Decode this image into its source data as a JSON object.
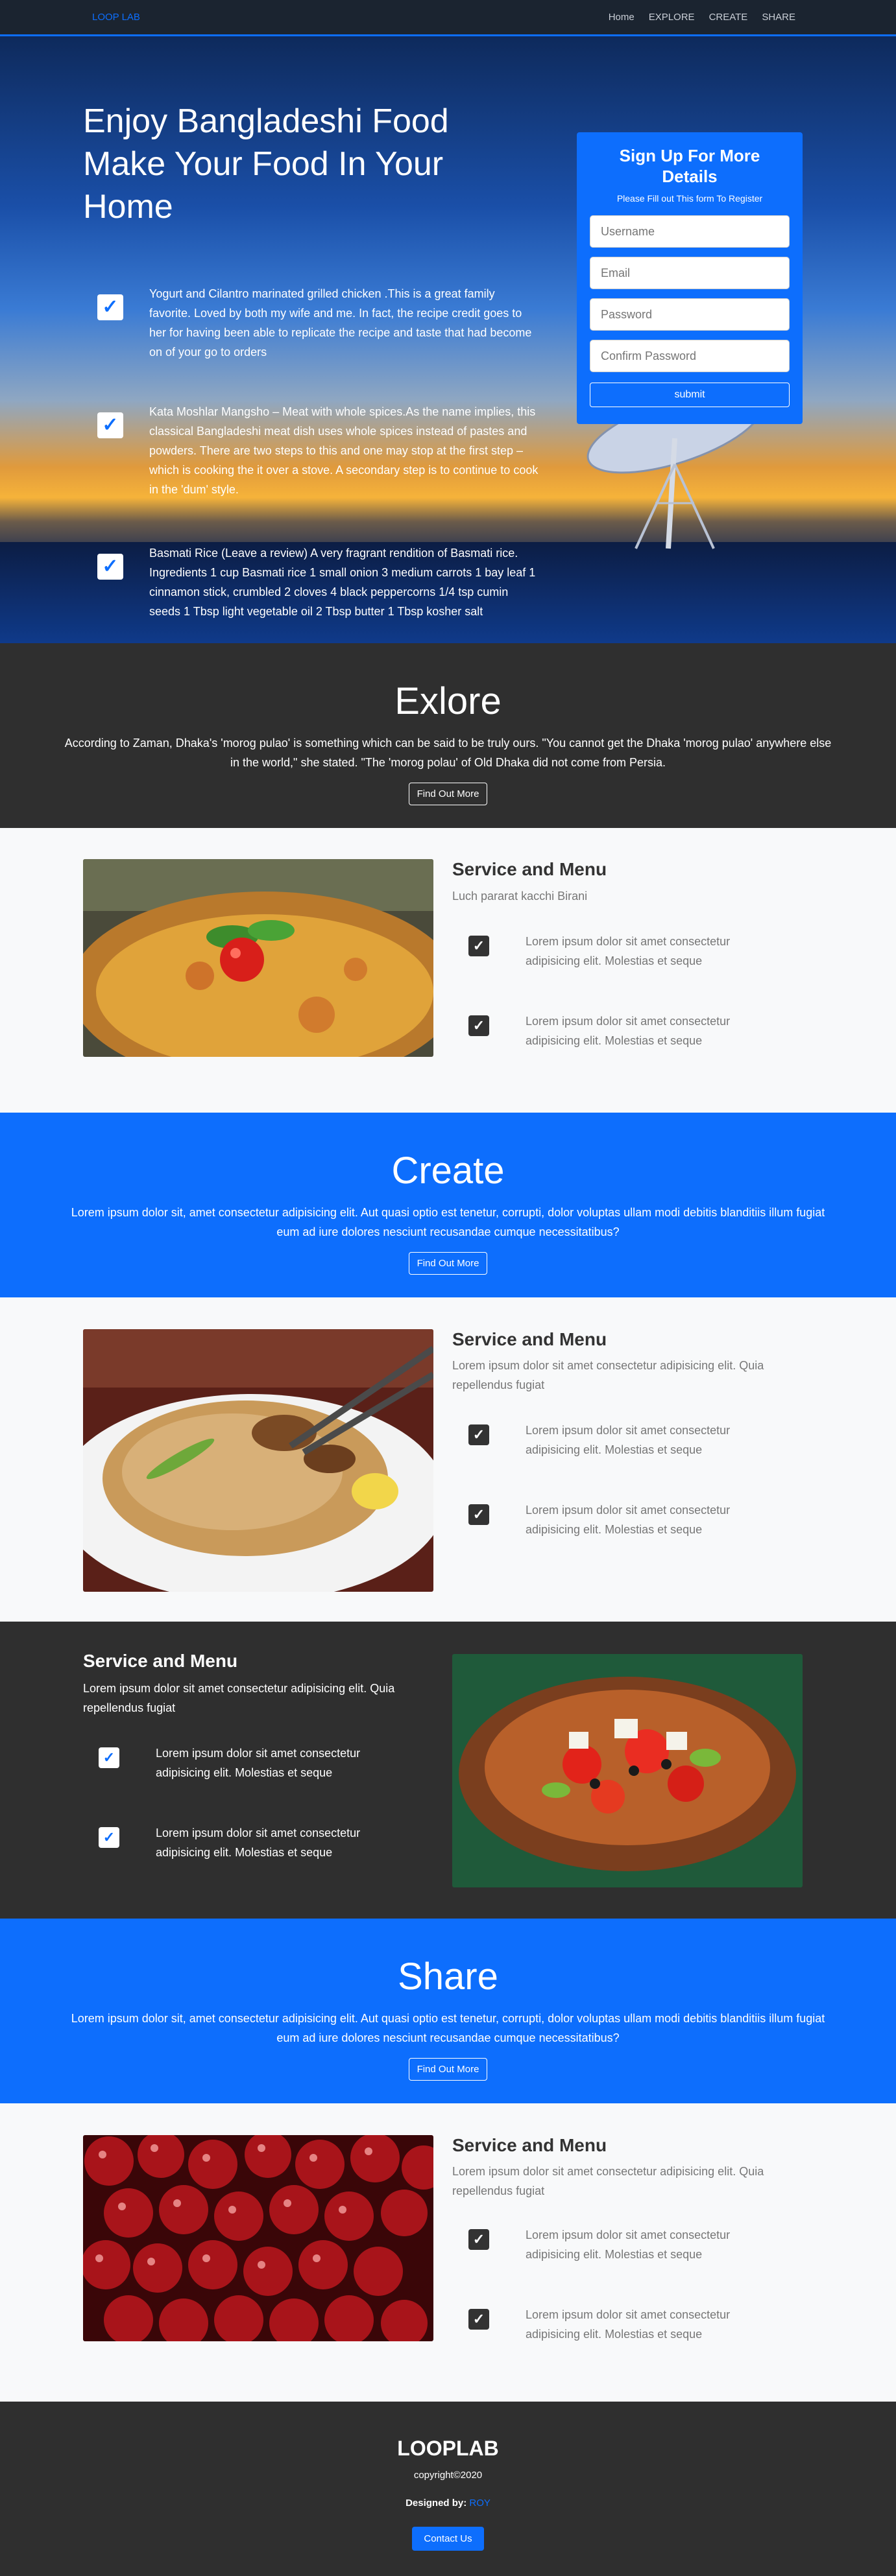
{
  "nav": {
    "brand": "LOOP LAB",
    "links": [
      "Home",
      "EXPLORE",
      "CREATE",
      "SHARE"
    ]
  },
  "hero": {
    "title_line1": "Enjoy Bangladeshi Food",
    "title_line2_light": "Make Your Food",
    "title_line2_bold": "In Your",
    "title_line3": "Home",
    "items": [
      "Yogurt and Cilantro marinated grilled chicken .This is a great family favorite. Loved by both my wife and me. In fact, the recipe credit goes to her for having been able to replicate the recipe and taste that had become on of your go to orders",
      "Kata Moshlar Mangsho – Meat with whole spices.As the name implies, this classical Bangladeshi meat dish uses whole spices instead of pastes and powders. There are two steps to this and one may stop at the first step – which is cooking the it over a stove. A secondary step is to continue to cook in the 'dum' style.",
      "Basmati Rice (Leave a review) A very fragrant rendition of Basmati rice. Ingredients 1 cup Basmati rice 1 small onion 3 medium carrots 1 bay leaf 1 cinnamon stick, crumbled 2 cloves 4 black peppercorns 1/4 tsp cumin seeds 1 Tbsp light vegetable oil 2 Tbsp butter 1 Tbsp kosher salt"
    ]
  },
  "signup": {
    "title": "Sign Up For More Details",
    "subtitle": "Please Fill out This form To Register",
    "username_placeholder": "Username",
    "email_placeholder": "Email",
    "password_placeholder": "Password",
    "confirm_placeholder": "Confirm Password",
    "submit_label": "submit"
  },
  "explore": {
    "title": "Exlore",
    "text": "According to Zaman, Dhaka's 'morog pulao' is something which can be said to be truly ours. \"You cannot get the Dhaka 'morog pulao' anywhere else in the world,\" she stated. \"The 'morog polau' of Old Dhaka did not come from Persia.",
    "button": "Find Out More"
  },
  "service1": {
    "title": "Service and Menu",
    "lead": "Luch pararat kacchi Birani",
    "items": [
      "Lorem ipsum dolor sit amet consectetur adipisicing elit. Molestias et seque",
      "Lorem ipsum dolor sit amet consectetur adipisicing elit. Molestias et seque"
    ]
  },
  "create": {
    "title": "Create",
    "text": "Lorem ipsum dolor sit, amet consectetur adipisicing elit. Aut quasi optio est tenetur, corrupti, dolor voluptas ullam modi debitis blanditiis illum fugiat eum ad iure dolores nesciunt recusandae cumque necessitatibus?",
    "button": "Find Out More"
  },
  "service2": {
    "title": "Service and Menu",
    "lead": "Lorem ipsum dolor sit amet consectetur adipisicing elit. Quia repellendus fugiat",
    "items": [
      "Lorem ipsum dolor sit amet consectetur adipisicing elit. Molestias et seque",
      "Lorem ipsum dolor sit amet consectetur adipisicing elit. Molestias et seque"
    ]
  },
  "service3": {
    "title": "Service and Menu",
    "lead": "Lorem ipsum dolor sit amet consectetur adipisicing elit. Quia repellendus fugiat",
    "items": [
      "Lorem ipsum dolor sit amet consectetur adipisicing elit. Molestias et seque",
      "Lorem ipsum dolor sit amet consectetur adipisicing elit. Molestias et seque"
    ]
  },
  "share": {
    "title": "Share",
    "text": "Lorem ipsum dolor sit, amet consectetur adipisicing elit. Aut quasi optio est tenetur, corrupti, dolor voluptas ullam modi debitis blanditiis illum fugiat eum ad iure dolores nesciunt recusandae cumque necessitatibus?",
    "button": "Find Out More"
  },
  "service4": {
    "title": "Service and Menu",
    "lead": "Lorem ipsum dolor sit amet consectetur adipisicing elit. Quia repellendus fugiat",
    "items": [
      "Lorem ipsum dolor sit amet consectetur adipisicing elit. Molestias et seque",
      "Lorem ipsum dolor sit amet consectetur adipisicing elit. Molestias et seque"
    ]
  },
  "footer": {
    "brand": "LOOPLAB",
    "copyright": "copyright©2020",
    "designed_label": "Designed by:",
    "designer": "ROY",
    "contact_button": "Contact Us"
  },
  "colors": {
    "accent": "#0d6efd",
    "dark": "#2f2f2f",
    "light": "#f8f9fa"
  },
  "icons": [
    "check-icon"
  ]
}
